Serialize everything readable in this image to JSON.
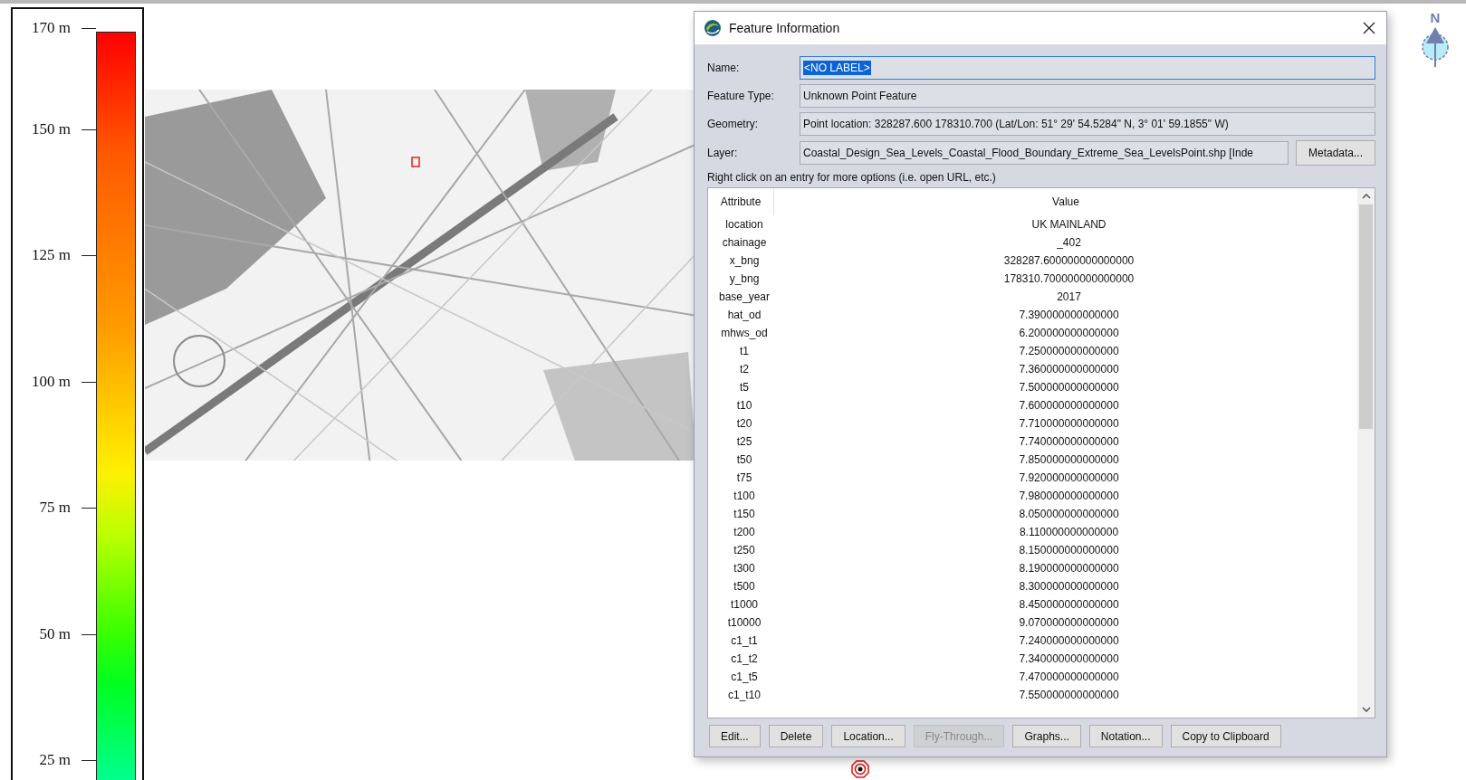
{
  "legend": {
    "ticks": [
      {
        "label": "170 m"
      },
      {
        "label": "150 m"
      },
      {
        "label": "125 m"
      },
      {
        "label": "100 m"
      },
      {
        "label": "75 m"
      },
      {
        "label": "50 m"
      },
      {
        "label": "25 m"
      }
    ]
  },
  "compass": {
    "label": "N"
  },
  "dialog": {
    "title": "Feature Information",
    "fields": [
      {
        "label": "Name:",
        "value": "<NO LABEL>",
        "selected": true
      },
      {
        "label": "Feature Type:",
        "value": "Unknown Point Feature",
        "selected": false
      },
      {
        "label": "Geometry:",
        "value": "Point location: 328287.600 178310.700 (Lat/Lon: 51° 29' 54.5284\" N, 3° 01' 59.1855\" W)",
        "selected": false
      },
      {
        "label": "Layer:",
        "value": "Coastal_Design_Sea_Levels_Coastal_Flood_Boundary_Extreme_Sea_LevelsPoint.shp [Inde",
        "selected": false
      }
    ],
    "metadata_button": "Metadata...",
    "hint": "Right click on an entry for more options (i.e. open URL, etc.)",
    "table": {
      "columns": [
        "Attribute",
        "Value"
      ],
      "rows": [
        [
          "location",
          "UK MAINLAND"
        ],
        [
          "chainage",
          "_402"
        ],
        [
          "x_bng",
          "328287.600000000000000"
        ],
        [
          "y_bng",
          "178310.700000000000000"
        ],
        [
          "base_year",
          "2017"
        ],
        [
          "hat_od",
          "7.390000000000000"
        ],
        [
          "mhws_od",
          "6.200000000000000"
        ],
        [
          "t1",
          "7.250000000000000"
        ],
        [
          "t2",
          "7.360000000000000"
        ],
        [
          "t5",
          "7.500000000000000"
        ],
        [
          "t10",
          "7.600000000000000"
        ],
        [
          "t20",
          "7.710000000000000"
        ],
        [
          "t25",
          "7.740000000000000"
        ],
        [
          "t50",
          "7.850000000000000"
        ],
        [
          "t75",
          "7.920000000000000"
        ],
        [
          "t100",
          "7.980000000000000"
        ],
        [
          "t150",
          "8.050000000000000"
        ],
        [
          "t200",
          "8.110000000000000"
        ],
        [
          "t250",
          "8.150000000000000"
        ],
        [
          "t300",
          "8.190000000000000"
        ],
        [
          "t500",
          "8.300000000000000"
        ],
        [
          "t1000",
          "8.450000000000000"
        ],
        [
          "t10000",
          "9.070000000000000"
        ],
        [
          "c1_t1",
          "7.240000000000000"
        ],
        [
          "c1_t2",
          "7.340000000000000"
        ],
        [
          "c1_t5",
          "7.470000000000000"
        ],
        [
          "c1_t10",
          "7.550000000000000"
        ]
      ]
    },
    "buttons": [
      {
        "label": "Edit...",
        "disabled": false
      },
      {
        "label": "Delete",
        "disabled": false
      },
      {
        "label": "Location...",
        "disabled": false
      },
      {
        "label": "Fly-Through...",
        "disabled": true
      },
      {
        "label": "Graphs...",
        "disabled": false
      },
      {
        "label": "Notation...",
        "disabled": false
      },
      {
        "label": "Copy to Clipboard",
        "disabled": false
      }
    ]
  }
}
